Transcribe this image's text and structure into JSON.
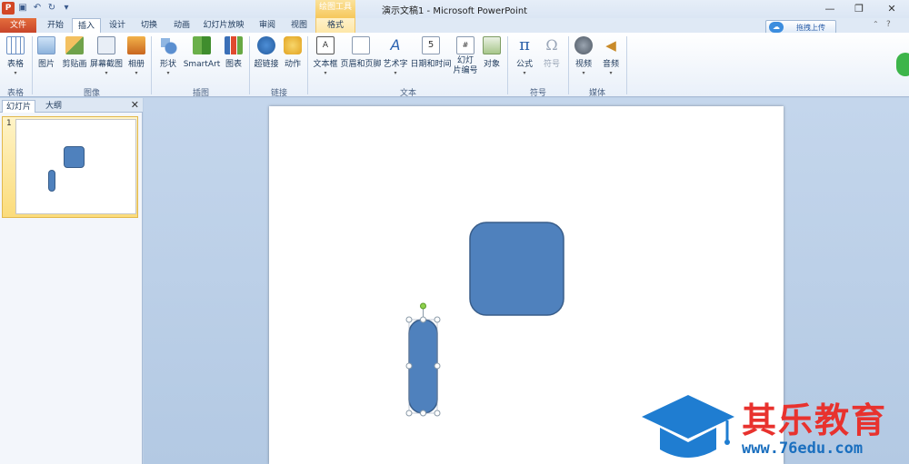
{
  "titlebar": {
    "title": "演示文稿1 - Microsoft PowerPoint",
    "context_tool": "绘图工具",
    "app_icon": "P"
  },
  "qat": [
    "save-icon",
    "undo-icon",
    "redo-icon",
    "customize-icon"
  ],
  "tabs": {
    "file": "文件",
    "home": "开始",
    "insert": "插入",
    "design": "设计",
    "transitions": "切换",
    "animations": "动画",
    "slideshow": "幻灯片放映",
    "review": "审阅",
    "view": "视图",
    "format": "格式"
  },
  "upload": {
    "label": "拖拽上传"
  },
  "ribbon": {
    "table": "表格",
    "picture": "图片",
    "clipart": "剪贴画",
    "screenshot": "屏幕截图",
    "album": "相册",
    "shapes": "形状",
    "smartart": "SmartArt",
    "chart": "图表",
    "hyperlink": "超链接",
    "action": "动作",
    "textbox": "文本框",
    "header_footer": "页眉和页脚",
    "wordart": "艺术字",
    "datetime": "日期和时间",
    "slide_number_1": "幻灯",
    "slide_number_2": "片编号",
    "object": "对象",
    "equation": "公式",
    "symbol": "符号",
    "video": "视频",
    "audio": "音频",
    "groups": {
      "tables": "表格",
      "images": "图像",
      "illustrations": "插图",
      "links": "链接",
      "text": "文本",
      "symbols": "符号",
      "media": "媒体"
    }
  },
  "pane": {
    "tab_slides": "幻灯片",
    "tab_outline": "大纲",
    "slide_number": "1"
  },
  "watermark": {
    "title": "其乐教育",
    "url": "www.76edu.com"
  },
  "colors": {
    "shape_fill": "#4f81bd",
    "shape_stroke": "#385d8a",
    "accent": "#d24726"
  }
}
